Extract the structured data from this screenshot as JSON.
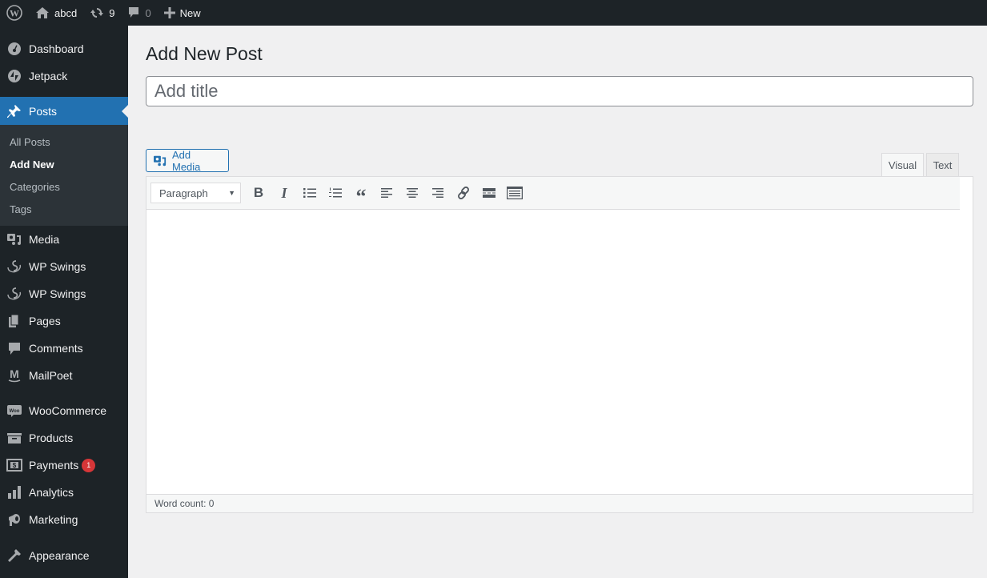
{
  "adminbar": {
    "site_name": "abcd",
    "updates_count": "9",
    "comments_count": "0",
    "new_label": "New"
  },
  "sidebar": {
    "items": [
      {
        "label": "Dashboard",
        "icon": "dashboard-icon"
      },
      {
        "label": "Jetpack",
        "icon": "jetpack-icon"
      },
      {
        "label": "Posts",
        "icon": "pin-icon",
        "current": true
      },
      {
        "label": "Media",
        "icon": "media-icon"
      },
      {
        "label": "WP Swings",
        "icon": "wpswings-icon"
      },
      {
        "label": "WP Swings",
        "icon": "wpswings-icon"
      },
      {
        "label": "Pages",
        "icon": "pages-icon"
      },
      {
        "label": "Comments",
        "icon": "comment-icon"
      },
      {
        "label": "MailPoet",
        "icon": "mailpoet-icon"
      },
      {
        "label": "WooCommerce",
        "icon": "woo-icon"
      },
      {
        "label": "Products",
        "icon": "archive-icon"
      },
      {
        "label": "Payments",
        "icon": "payments-icon",
        "badge": "1"
      },
      {
        "label": "Analytics",
        "icon": "bar-chart-icon"
      },
      {
        "label": "Marketing",
        "icon": "megaphone-icon"
      },
      {
        "label": "Appearance",
        "icon": "paintbrush-icon"
      }
    ],
    "posts_submenu": [
      {
        "label": "All Posts"
      },
      {
        "label": "Add New",
        "current": true
      },
      {
        "label": "Categories"
      },
      {
        "label": "Tags"
      }
    ]
  },
  "main": {
    "page_title": "Add New Post",
    "title_input": {
      "value": "",
      "placeholder": "Add title"
    },
    "add_media_label": "Add Media",
    "tabs": [
      {
        "label": "Visual",
        "active": true
      },
      {
        "label": "Text",
        "active": false
      }
    ],
    "toolbar": {
      "format_value": "Paragraph",
      "buttons": [
        "Bold",
        "Italic",
        "Bulleted list",
        "Numbered list",
        "Blockquote",
        "Align left",
        "Align center",
        "Align right",
        "Insert/edit link",
        "Insert Read More tag",
        "Toolbar Toggle"
      ],
      "bold_glyph": "B",
      "italic_glyph": "I",
      "quote_glyph": "“"
    },
    "word_count": "Word count: 0"
  },
  "colors": {
    "accent": "#2271b1",
    "adminbar_bg": "#1d2327",
    "badge": "#d63638"
  }
}
